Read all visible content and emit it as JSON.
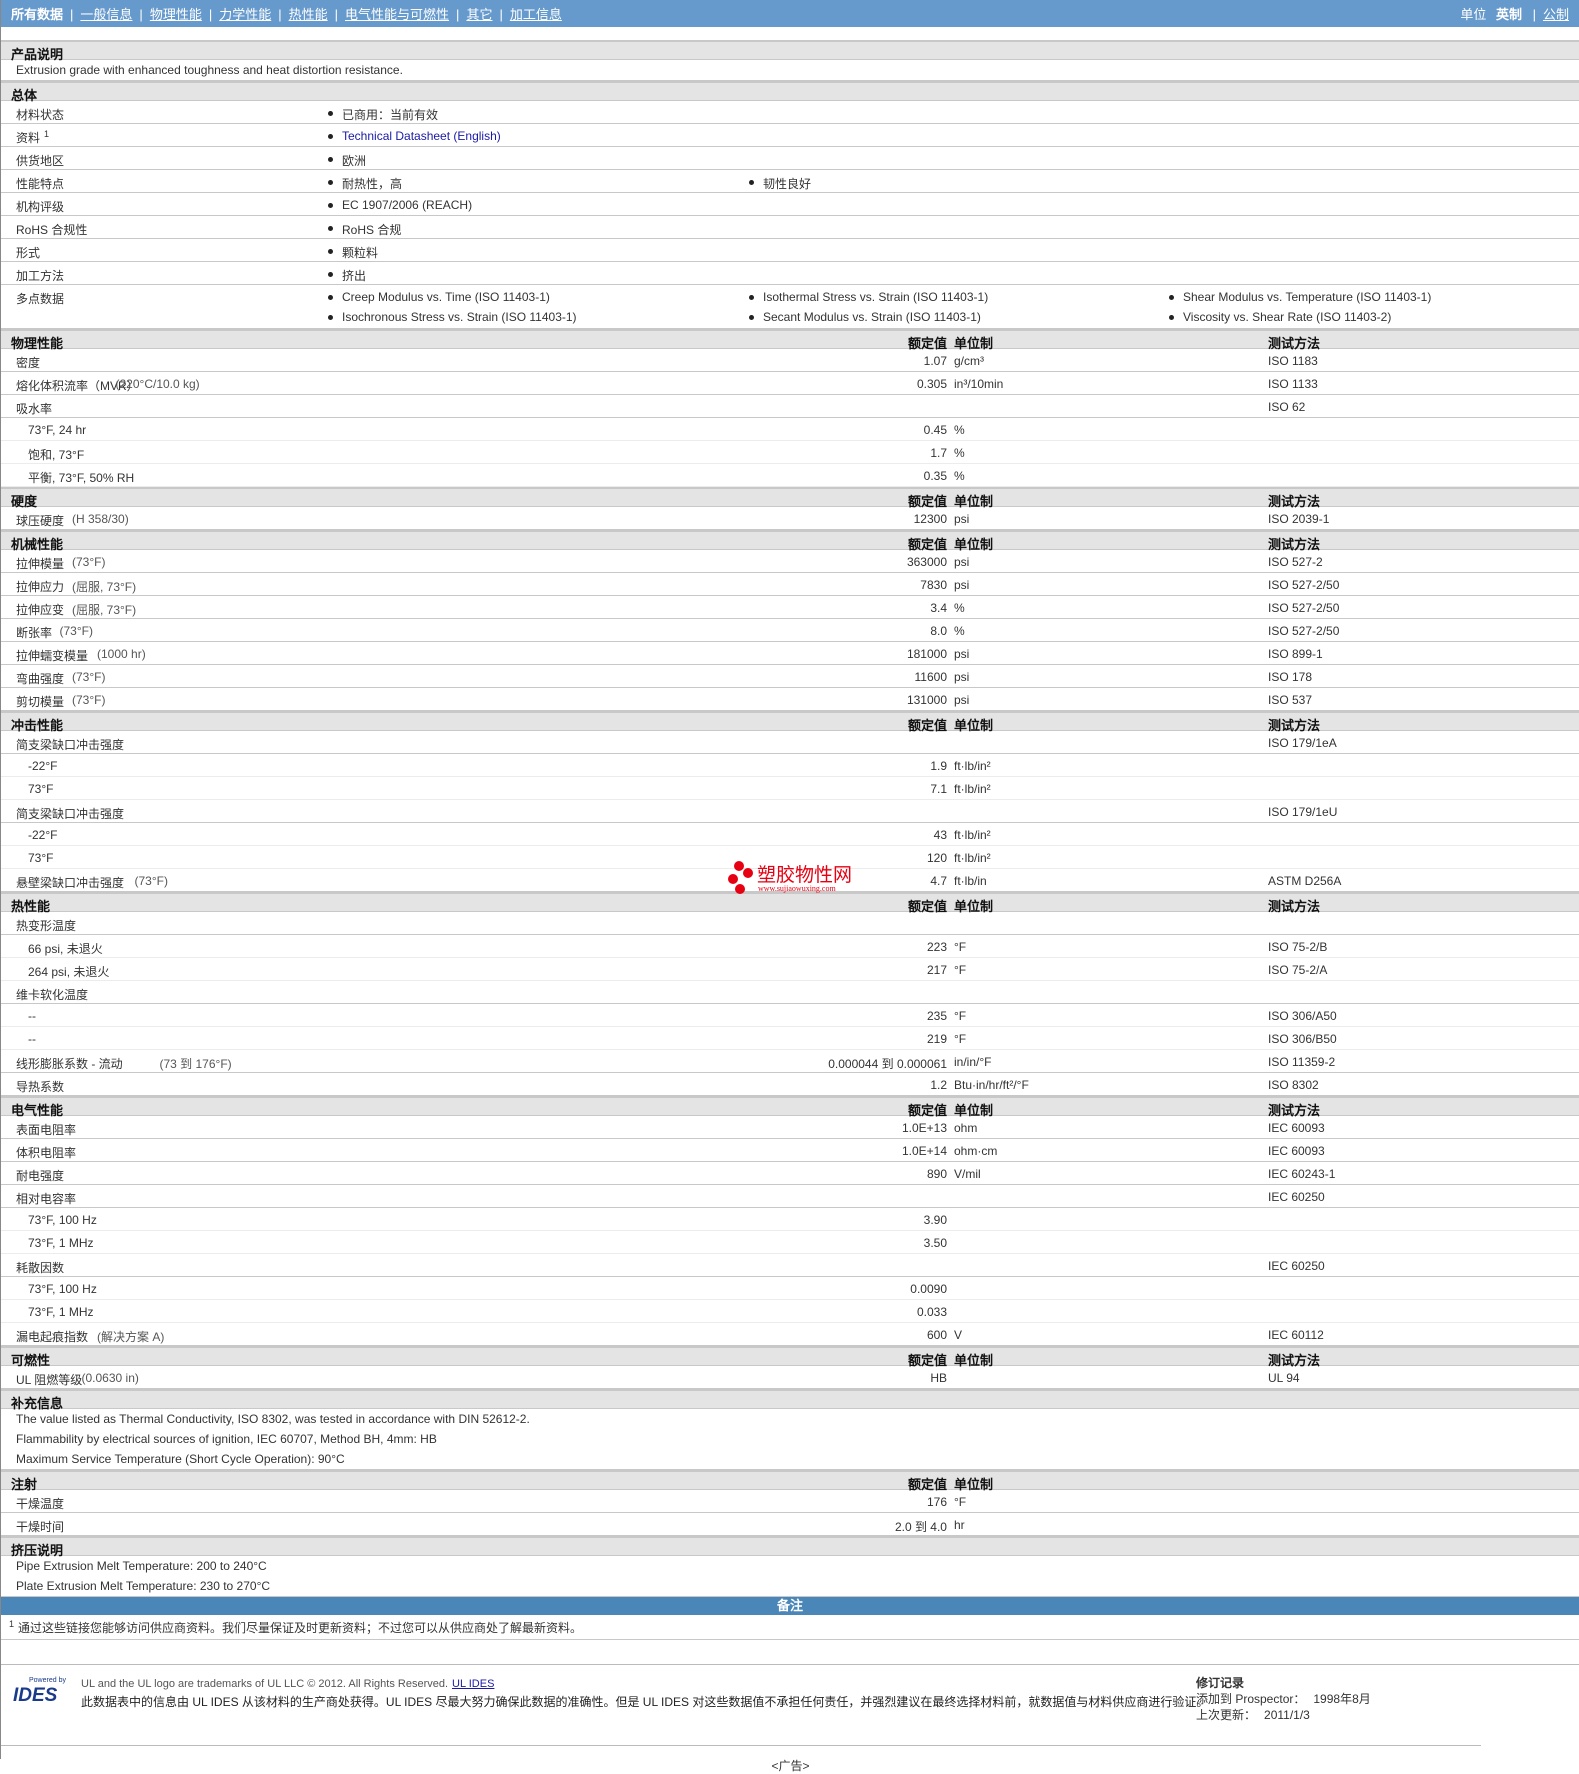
{
  "nav": {
    "items": [
      "所有数据",
      "一般信息",
      "物理性能",
      "力学性能",
      "热性能",
      "电气性能与可燃性",
      "其它",
      "加工信息"
    ],
    "units_label": "单位",
    "unit_active": "英制",
    "unit_other": "公制"
  },
  "product": {
    "title": "产品说明",
    "text": "Extrusion grade with enhanced toughness and heat distortion resistance."
  },
  "general": {
    "title": "总体",
    "rows": [
      {
        "label": "材料状态",
        "items": [
          "已商用：当前有效"
        ]
      },
      {
        "label": "资料",
        "sup": "1",
        "items": [
          "Technical Datasheet (English)"
        ],
        "link": true
      },
      {
        "label": "供货地区",
        "items": [
          "欧洲"
        ]
      },
      {
        "label": "性能特点",
        "items": [
          "耐热性，高",
          "韧性良好"
        ]
      },
      {
        "label": "机构评级",
        "items": [
          "EC 1907/2006 (REACH)"
        ]
      },
      {
        "label": "RoHS 合规性",
        "items": [
          "RoHS 合规"
        ]
      },
      {
        "label": "形式",
        "items": [
          "颗粒料"
        ]
      },
      {
        "label": "加工方法",
        "items": [
          "挤出"
        ]
      },
      {
        "label": "多点数据",
        "items": [
          "Creep Modulus vs. Time (ISO 11403-1)",
          "Isothermal Stress vs. Strain (ISO 11403-1)",
          "Shear Modulus vs. Temperature (ISO 11403-1)",
          "Isochronous Stress vs. Strain (ISO 11403-1)",
          "Secant Modulus vs. Strain (ISO 11403-1)",
          "Viscosity vs. Shear Rate (ISO 11403-2)"
        ],
        "two": true
      }
    ]
  },
  "col_headers": {
    "value": "额定值",
    "unit": "单位制",
    "method": "测试方法"
  },
  "sections": [
    {
      "title": "物理性能",
      "method": true,
      "rows": [
        {
          "label": "密度",
          "value": "1.07",
          "unit": "g/cm³",
          "method": "ISO 1183"
        },
        {
          "label": "熔化体积流率（MVR）",
          "note": "(220°C/10.0 kg)",
          "value": "0.305",
          "unit": "in³/10min",
          "method": "ISO 1133"
        },
        {
          "label": "吸水率",
          "method": "ISO 62"
        },
        {
          "label": "73°F, 24 hr",
          "value": "0.45",
          "unit": "%",
          "sub": true
        },
        {
          "label": "饱和, 73°F",
          "value": "1.7",
          "unit": "%",
          "sub": true
        },
        {
          "label": "平衡, 73°F, 50% RH",
          "value": "0.35",
          "unit": "%",
          "sub": true
        }
      ]
    },
    {
      "title": "硬度",
      "method": true,
      "rows": [
        {
          "label": "球压硬度",
          "note": "(H 358/30)",
          "value": "12300",
          "unit": "psi",
          "method": "ISO 2039-1"
        }
      ]
    },
    {
      "title": "机械性能",
      "method": true,
      "rows": [
        {
          "label": "拉伸模量",
          "note": "(73°F)",
          "value": "363000",
          "unit": "psi",
          "method": "ISO 527-2"
        },
        {
          "label": "拉伸应力",
          "note": "(屈服, 73°F)",
          "value": "7830",
          "unit": "psi",
          "method": "ISO 527-2/50"
        },
        {
          "label": "拉伸应变",
          "note": "(屈服, 73°F)",
          "value": "3.4",
          "unit": "%",
          "method": "ISO 527-2/50"
        },
        {
          "label": "断张率",
          "note": "(73°F)",
          "value": "8.0",
          "unit": "%",
          "method": "ISO 527-2/50"
        },
        {
          "label": "拉伸蠕变模量",
          "note": "(1000 hr)",
          "value": "181000",
          "unit": "psi",
          "method": "ISO 899-1"
        },
        {
          "label": "弯曲强度",
          "note": "(73°F)",
          "value": "11600",
          "unit": "psi",
          "method": "ISO 178"
        },
        {
          "label": "剪切模量",
          "note": "(73°F)",
          "value": "131000",
          "unit": "psi",
          "method": "ISO 537"
        }
      ]
    },
    {
      "title": "冲击性能",
      "method": true,
      "rows": [
        {
          "label": "简支梁缺口冲击强度",
          "method": "ISO 179/1eA"
        },
        {
          "label": "-22°F",
          "value": "1.9",
          "unit": "ft·lb/in²",
          "sub": true
        },
        {
          "label": "73°F",
          "value": "7.1",
          "unit": "ft·lb/in²",
          "sub": true
        },
        {
          "label": "简支梁缺口冲击强度",
          "method": "ISO 179/1eU"
        },
        {
          "label": "-22°F",
          "value": "43",
          "unit": "ft·lb/in²",
          "sub": true
        },
        {
          "label": "73°F",
          "value": "120",
          "unit": "ft·lb/in²",
          "sub": true
        },
        {
          "label": "悬壁梁缺口冲击强度",
          "note": "(73°F)",
          "value": "4.7",
          "unit": "ft·lb/in",
          "method": "ASTM D256A"
        }
      ]
    },
    {
      "title": "热性能",
      "method": true,
      "rows": [
        {
          "label": "热变形温度"
        },
        {
          "label": "66 psi, 未退火",
          "value": "223",
          "unit": "°F",
          "method": "ISO 75-2/B",
          "sub": true
        },
        {
          "label": "264 psi, 未退火",
          "value": "217",
          "unit": "°F",
          "method": "ISO 75-2/A",
          "sub": true
        },
        {
          "label": "维卡软化温度"
        },
        {
          "label": "--",
          "value": "235",
          "unit": "°F",
          "method": "ISO 306/A50",
          "sub": true
        },
        {
          "label": "--",
          "value": "219",
          "unit": "°F",
          "method": "ISO 306/B50",
          "sub": true
        },
        {
          "label": "线形膨胀系数 - 流动",
          "note": "(73 到 176°F)",
          "value": "0.000044 到 0.000061",
          "unit": "in/in/°F",
          "method": "ISO 11359-2"
        },
        {
          "label": "导热系数",
          "value": "1.2",
          "unit": "Btu·in/hr/ft²/°F",
          "method": "ISO 8302"
        }
      ]
    },
    {
      "title": "电气性能",
      "method": true,
      "rows": [
        {
          "label": "表面电阻率",
          "value": "1.0E+13",
          "unit": "ohm",
          "method": "IEC 60093"
        },
        {
          "label": "体积电阻率",
          "value": "1.0E+14",
          "unit": "ohm·cm",
          "method": "IEC 60093"
        },
        {
          "label": "耐电强度",
          "value": "890",
          "unit": "V/mil",
          "method": "IEC 60243-1"
        },
        {
          "label": "相对电容率",
          "method": "IEC 60250"
        },
        {
          "label": "73°F, 100 Hz",
          "value": "3.90",
          "sub": true
        },
        {
          "label": "73°F, 1 MHz",
          "value": "3.50",
          "sub": true
        },
        {
          "label": "耗散因数",
          "method": "IEC 60250"
        },
        {
          "label": "73°F, 100 Hz",
          "value": "0.0090",
          "sub": true
        },
        {
          "label": "73°F, 1 MHz",
          "value": "0.033",
          "sub": true
        },
        {
          "label": "漏电起痕指数",
          "note": "(解决方案 A)",
          "value": "600",
          "unit": "V",
          "method": "IEC 60112"
        }
      ]
    },
    {
      "title": "可燃性",
      "method": true,
      "rows": [
        {
          "label": "UL 阻燃等级",
          "note": "(0.0630 in)",
          "value": "HB",
          "method": "UL 94"
        }
      ]
    }
  ],
  "supplement": {
    "title": "补充信息",
    "lines": [
      "The value listed as Thermal Conductivity, ISO 8302, was tested in accordance with DIN 52612-2.",
      "Flammability by electrical sources of ignition, IEC 60707, Method BH, 4mm: HB",
      "Maximum Service Temperature (Short Cycle Operation): 90°C"
    ]
  },
  "injection": {
    "title": "注射",
    "rows": [
      {
        "label": "干燥温度",
        "value": "176",
        "unit": "°F"
      },
      {
        "label": "干燥时间",
        "value": "2.0 到 4.0",
        "unit": "hr"
      }
    ]
  },
  "extrusion": {
    "title": "挤压说明",
    "lines": [
      "Pipe Extrusion Melt Temperature: 200 to 240°C",
      "Plate Extrusion Melt Temperature: 230 to 270°C"
    ]
  },
  "remarks": {
    "title": "备注",
    "sup": "1",
    "text": "通过这些链接您能够访问供应商资料。我们尽量保证及时更新资料；不过您可以从供应商处了解最新资料。"
  },
  "watermark": {
    "name": "塑胶物性网",
    "url": "www.sujiaowuxing.com"
  },
  "footer": {
    "logo_powered": "Powered by",
    "logo": "IDES",
    "trademark": "UL and the UL logo are trademarks of UL LLC © 2012. All Rights Reserved.",
    "trademark_link": "UL IDES",
    "disclaimer": "此数据表中的信息由 UL IDES 从该材料的生产商处获得。UL IDES 尽最大努力确保此数据的准确性。但是 UL IDES 对这些数据值不承担任何责任，并强烈建议在最终选择材料前，就数据值与材料供应商进行验证。",
    "rev_title": "修订记录",
    "added_label": "添加到 Prospector：",
    "added": "1998年8月",
    "updated_label": "上次更新：",
    "updated": "2011/1/3",
    "ad": "<广告>"
  }
}
